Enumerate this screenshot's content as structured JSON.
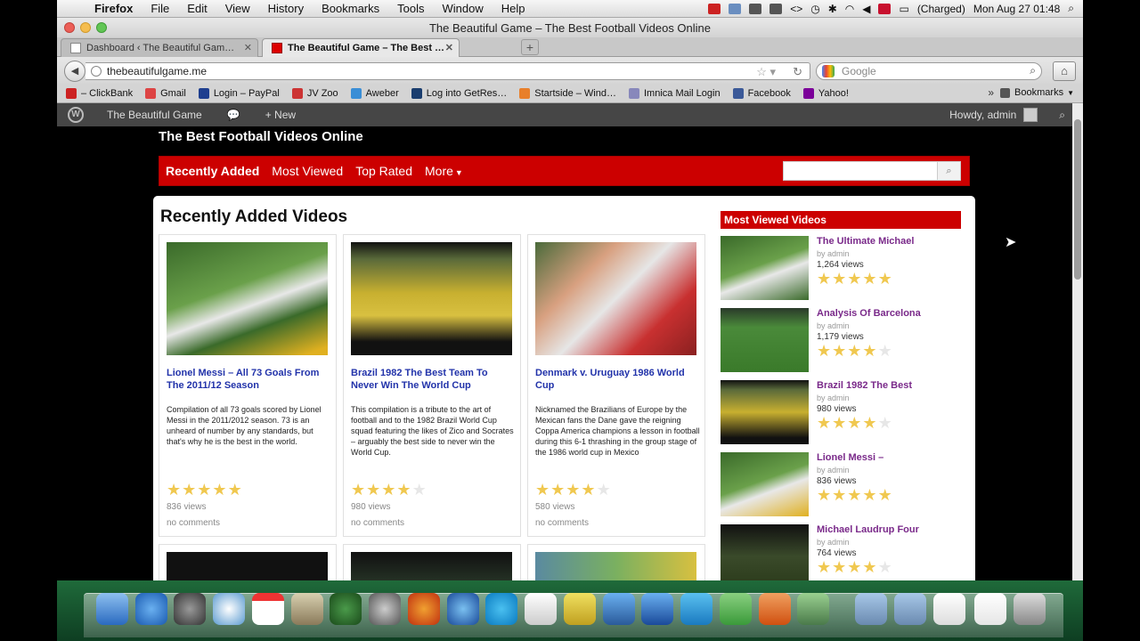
{
  "menubar": {
    "apple": "",
    "app_name": "Firefox",
    "menus": [
      "File",
      "Edit",
      "View",
      "History",
      "Bookmarks",
      "Tools",
      "Window",
      "Help"
    ],
    "battery": "(Charged)",
    "clock": "Mon Aug 27  01:48"
  },
  "window": {
    "title": "The Beautiful Game – The Best Football Videos Online"
  },
  "tabs": [
    {
      "label": "Dashboard ‹ The Beautiful Gam…"
    },
    {
      "label": "The Beautiful Game – The Best …"
    }
  ],
  "toolbar": {
    "url": "thebeautifulgame.me",
    "search_placeholder": "Google"
  },
  "bookmarks": [
    {
      "label": "– ClickBank",
      "color": "#cc2222"
    },
    {
      "label": "Gmail",
      "color": "#d44"
    },
    {
      "label": "Login – PayPal",
      "color": "#1f3f8f"
    },
    {
      "label": "JV Zoo",
      "color": "#c33"
    },
    {
      "label": "Aweber",
      "color": "#3a8ed6"
    },
    {
      "label": "Log into GetRes…",
      "color": "#1a3d6e"
    },
    {
      "label": "Startside – Wind…",
      "color": "#e87f2a"
    },
    {
      "label": "Imnica Mail Login",
      "color": "#8888bb"
    },
    {
      "label": "Facebook",
      "color": "#3b5998"
    },
    {
      "label": "Yahoo!",
      "color": "#7b0099"
    }
  ],
  "bookmarks_more": "»",
  "bookmarks_folder": "Bookmarks",
  "wpbar": {
    "logo": "W",
    "site": "The Beautiful Game",
    "new": "+ New",
    "howdy": "Howdy, admin"
  },
  "site": {
    "tagline": "The Best Football Videos Online",
    "nav": [
      "Recently Added",
      "Most Viewed",
      "Top Rated",
      "More"
    ],
    "nav_more_caret": "▼"
  },
  "recent": {
    "heading": "Recently Added Videos",
    "cards": [
      {
        "title": "Lionel Messi – All 73 Goals From The 2011/12 Season",
        "desc": "Compilation of all 73 goals scored by Lionel Messi in the 2011/2012 season. 73 is an unheard of number by any standards, but that's why he is the best in the world.",
        "rating": 5,
        "views": "836 views",
        "comments": "no comments"
      },
      {
        "title": "Brazil 1982 The Best Team To Never Win The World Cup",
        "desc": "This compilation is a tribute to the art of football and to the 1982 Brazil World Cup squad featuring the likes of Zico and Socrates – arguably the best side to never win the World Cup.",
        "rating": 4,
        "views": "980 views",
        "comments": "no comments"
      },
      {
        "title": "Denmark v. Uruguay 1986 World Cup",
        "desc": "Nicknamed the Brazilians of Europe by the Mexican fans the Dane gave the reigning Coppa America champions a lesson in football during this 6-1 thrashing in the group stage of the 1986 world cup in Mexico",
        "rating": 4,
        "views": "580 views",
        "comments": "no comments"
      }
    ]
  },
  "most_viewed": {
    "heading": "Most Viewed Videos",
    "items": [
      {
        "title": "The Ultimate Michael",
        "by": "by admin",
        "views": "1,264 views",
        "rating": 5
      },
      {
        "title": "Analysis Of Barcelona",
        "by": "by admin",
        "views": "1,179 views",
        "rating": 4
      },
      {
        "title": "Brazil 1982 The Best",
        "by": "by admin",
        "views": "980 views",
        "rating": 4
      },
      {
        "title": "Lionel Messi –",
        "by": "by admin",
        "views": "836 views",
        "rating": 5
      },
      {
        "title": "Michael Laudrup Four",
        "by": "by admin",
        "views": "764 views",
        "rating": 4
      }
    ]
  }
}
